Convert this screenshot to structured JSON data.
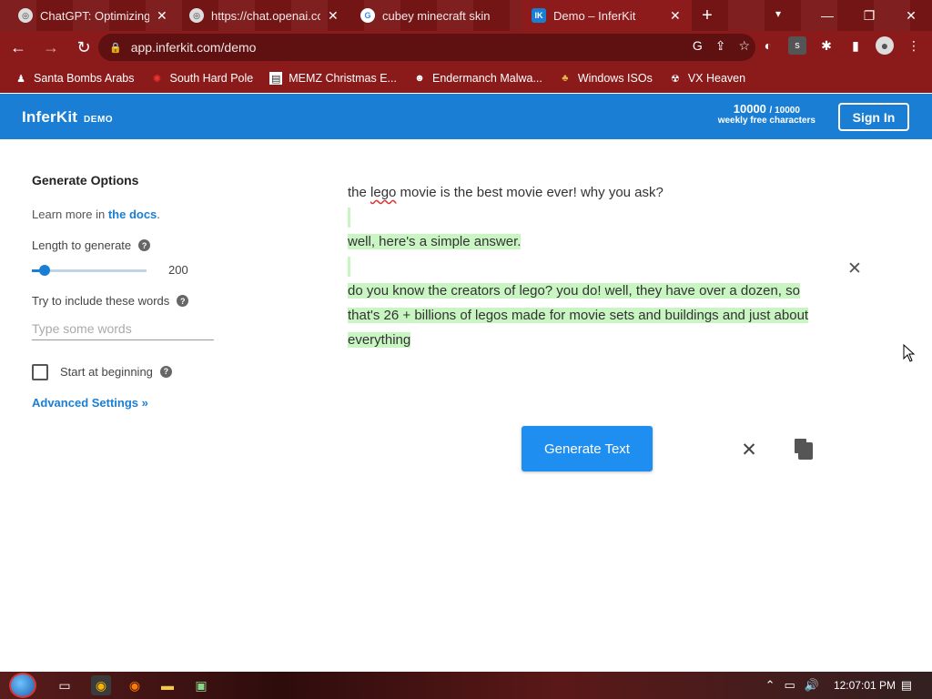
{
  "browser": {
    "tabs": [
      {
        "title": "ChatGPT: Optimizing L",
        "icon": "chatgpt-icon",
        "close": "✕"
      },
      {
        "title": "https://chat.openai.co",
        "icon": "openai-icon",
        "close": "✕"
      },
      {
        "title": "cubey minecraft skin -",
        "icon": "google-icon",
        "close": "✕"
      },
      {
        "title": "Demo – InferKit",
        "icon": "inferkit-icon",
        "close": "✕",
        "active": true
      }
    ],
    "new_tab": "+",
    "url": "app.inferkit.com/demo",
    "bookmarks": [
      {
        "label": "Santa Bombs Arabs",
        "icon": "santa-icon"
      },
      {
        "label": "South Hard Pole",
        "icon": "pole-icon"
      },
      {
        "label": "MEMZ Christmas E...",
        "icon": "memz-icon"
      },
      {
        "label": "Endermanch Malwa...",
        "icon": "endermanch-icon"
      },
      {
        "label": "Windows ISOs",
        "icon": "windows-iso-icon"
      },
      {
        "label": "VX Heaven",
        "icon": "vx-heaven-icon"
      }
    ]
  },
  "header": {
    "logo": "InferKit",
    "logo_badge": "DEMO",
    "quota_used": "10000",
    "quota_total": "/ 10000",
    "quota_caption": "weekly free characters",
    "signin_label": "Sign In"
  },
  "options": {
    "title": "Generate Options",
    "learn_prefix": "Learn more in ",
    "learn_link": "the docs",
    "learn_suffix": ".",
    "length_label": "Length to generate",
    "length_value": "200",
    "length_fraction": 0.11,
    "words_label": "Try to include these words",
    "words_placeholder": "Type some words",
    "words_value": "",
    "start_label": "Start at beginning",
    "start_checked": false,
    "advanced_label": "Advanced Settings »"
  },
  "output": {
    "prompt_pre": "the ",
    "prompt_mis": "lego",
    "prompt_post": " movie is the best movie ever! why you ask?",
    "gen_line1": "well, here's a simple answer.",
    "gen_line2": "do you know the creators of lego? you do! well, they have over a dozen, so that's 26 + billions of legos made for movie sets and buildings and just about everything"
  },
  "actions": {
    "generate_label": "Generate Text"
  },
  "taskbar": {
    "time": "12:07:01 PM"
  },
  "colors": {
    "brand": "#1a7fd4",
    "generated_highlight": "#c9f5c3",
    "browser_frame": "#8b1a1a"
  }
}
